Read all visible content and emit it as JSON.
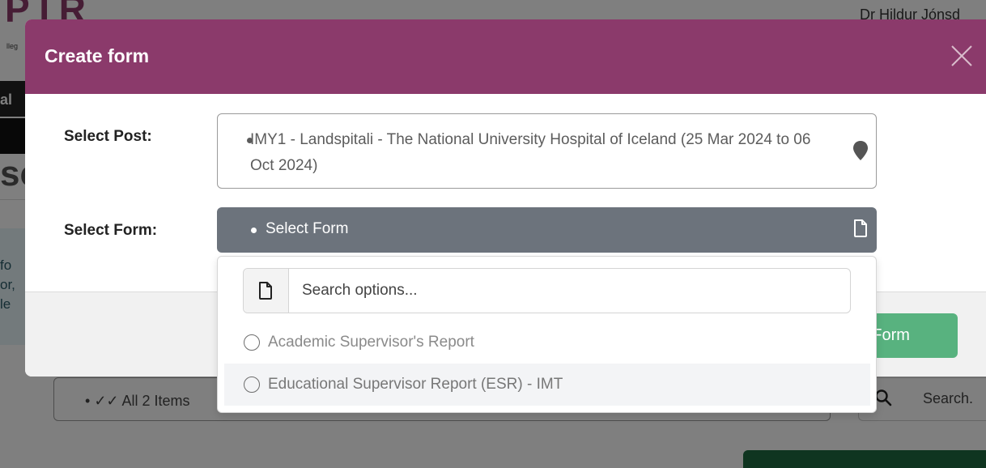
{
  "background": {
    "logo_text": "PTR",
    "logo_subtext": "lleg",
    "user_name": "Dr Hildur Jónsd",
    "nav_text": "al",
    "heading_fragment": "sc",
    "info_text": "fo\nor,\nle",
    "items_button": "All 2 Items",
    "search_text": "Search."
  },
  "modal": {
    "title": "Create form",
    "post_label": "Select Post:",
    "post_value": "IMY1 - Landspitali - The National University Hospital of Iceland (25 Mar 2024 to 06 Oct 2024)",
    "form_label": "Select Form:",
    "form_value": "Select Form",
    "create_button": "te Form"
  },
  "dropdown": {
    "search_placeholder": "Search options...",
    "options": [
      {
        "label": "Academic Supervisor's Report"
      },
      {
        "label": "Educational Supervisor Report (ESR) - IMT"
      }
    ]
  },
  "colors": {
    "header": "#8b3a6b",
    "select_bg": "#6c737c",
    "create_button": "#58b27f"
  }
}
